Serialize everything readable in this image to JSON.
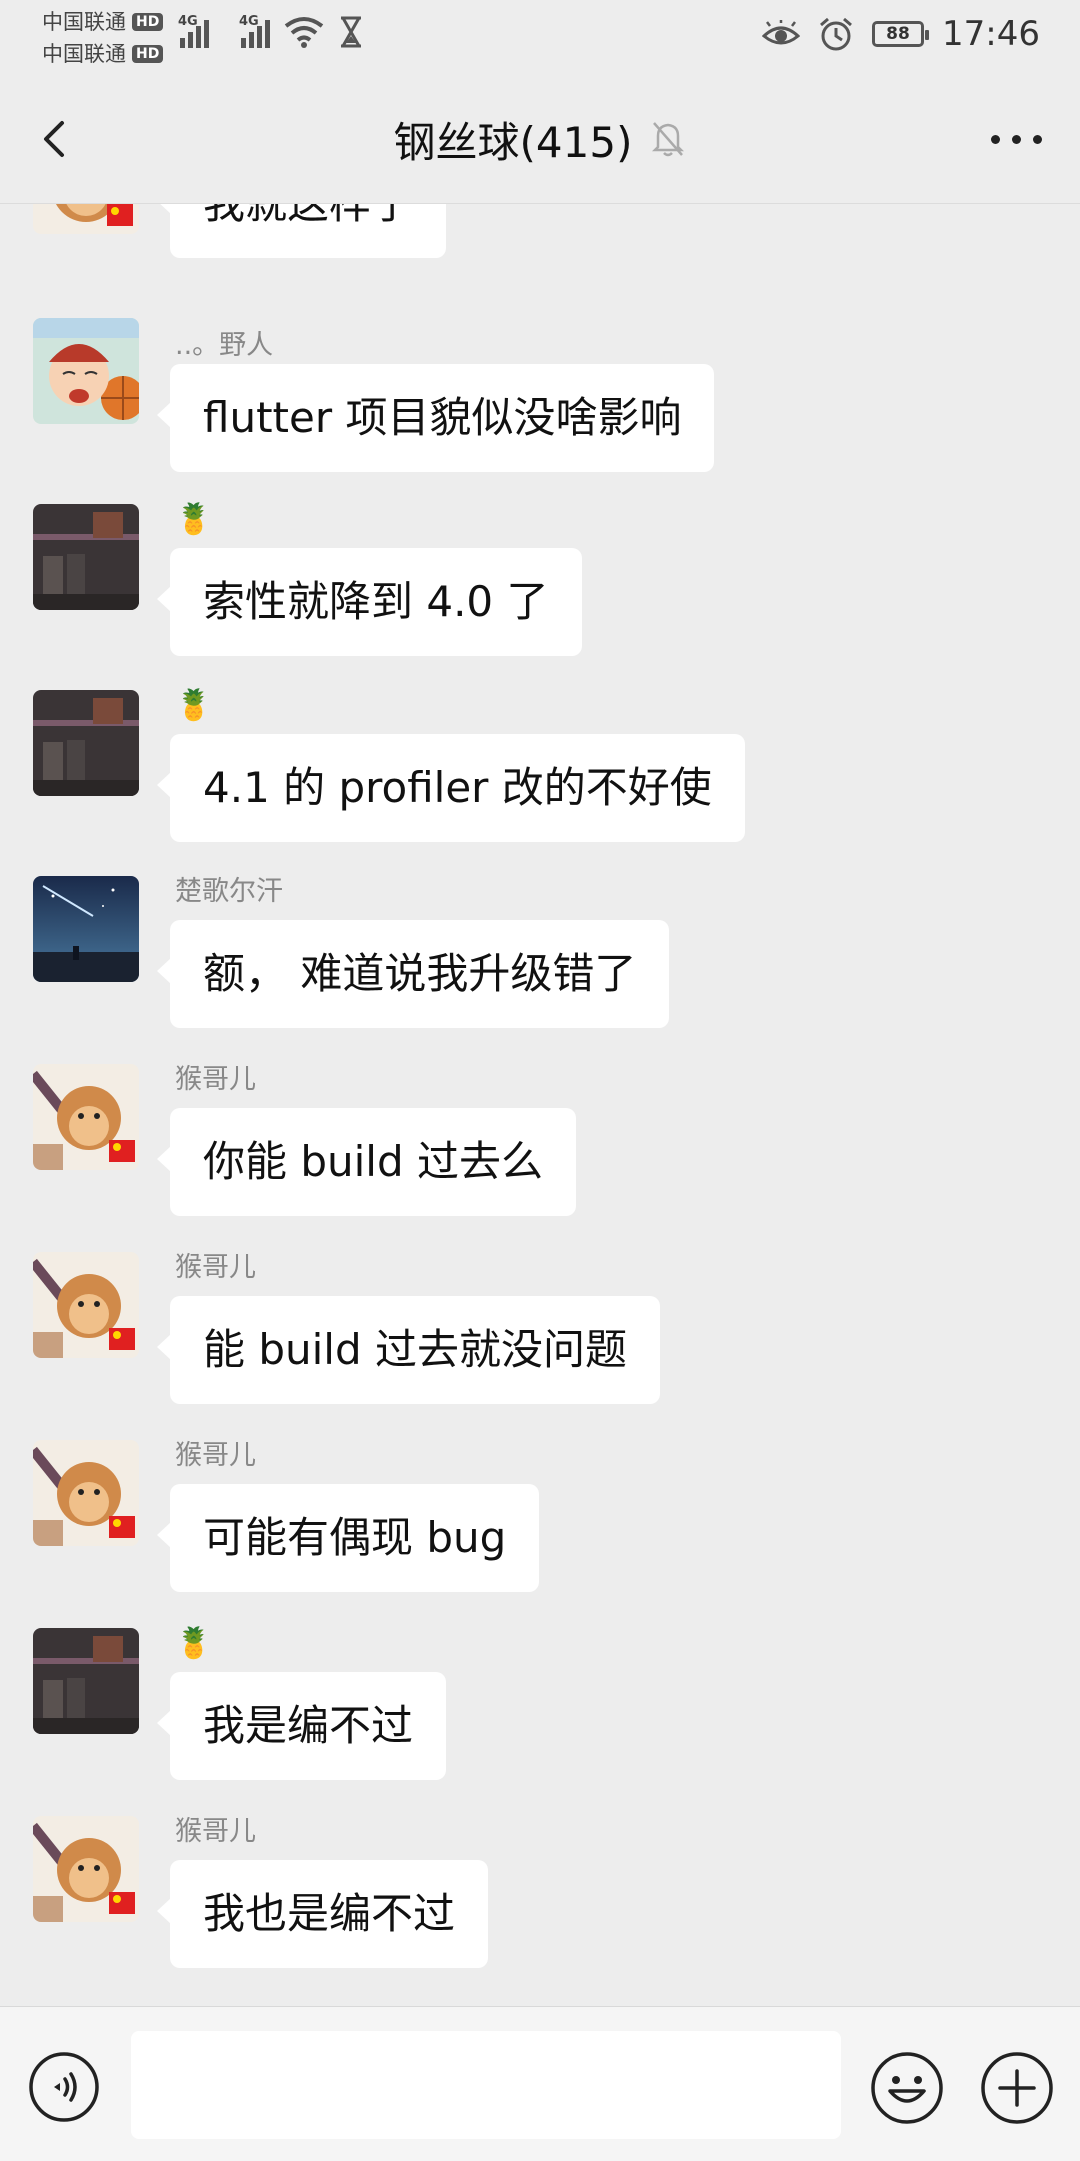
{
  "status_bar": {
    "carrier1": "中国联通",
    "carrier2": "中国联通",
    "hd_badge": "HD",
    "network": "4G",
    "battery": "88",
    "time": "17:46"
  },
  "nav": {
    "title": "钢丝球(415)"
  },
  "messages": [
    {
      "sender": "",
      "text": "我就这样了",
      "avatar": "monkey-avatar"
    },
    {
      "sender": "..。野人",
      "text": "flutter 项目貌似没啥影响",
      "avatar": "cartoon-avatar"
    },
    {
      "sender": "🍍",
      "text": "索性就降到 4.0 了",
      "avatar": "dark-photo-avatar"
    },
    {
      "sender": "🍍",
      "text": "4.1 的 profiler 改的不好使",
      "avatar": "dark-photo-avatar"
    },
    {
      "sender": "楚歌尔汗",
      "text": "额， 难道说我升级错了",
      "avatar": "night-sky-avatar"
    },
    {
      "sender": "猴哥儿",
      "text": "你能 build 过去么",
      "avatar": "monkey-avatar"
    },
    {
      "sender": "猴哥儿",
      "text": "能 build 过去就没问题",
      "avatar": "monkey-avatar"
    },
    {
      "sender": "猴哥儿",
      "text": "可能有偶现 bug",
      "avatar": "monkey-avatar"
    },
    {
      "sender": "🍍",
      "text": "我是编不过",
      "avatar": "dark-photo-avatar"
    },
    {
      "sender": "猴哥儿",
      "text": "我也是编不过",
      "avatar": "monkey-avatar"
    }
  ],
  "input": {
    "value": "",
    "placeholder": ""
  },
  "colors": {
    "background": "#ededed",
    "bubble": "#ffffff",
    "sender_text": "#888888"
  }
}
